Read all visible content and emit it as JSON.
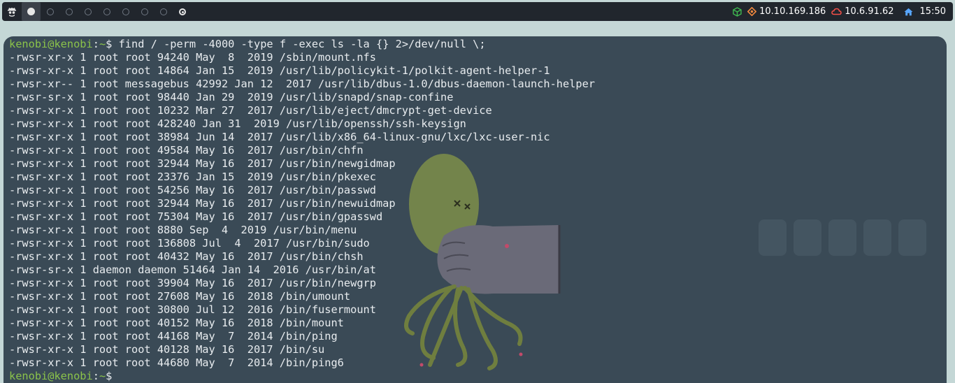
{
  "topbar": {
    "workspaces": [
      {
        "id": 1,
        "state": "active"
      },
      {
        "id": 2,
        "state": "empty"
      },
      {
        "id": 3,
        "state": "empty"
      },
      {
        "id": 4,
        "state": "empty"
      },
      {
        "id": 5,
        "state": "empty"
      },
      {
        "id": 6,
        "state": "empty"
      },
      {
        "id": 7,
        "state": "empty"
      },
      {
        "id": 8,
        "state": "empty"
      },
      {
        "id": 9,
        "state": "target"
      }
    ],
    "status": {
      "target_ip": "10.10.169.186",
      "vpn_ip": "10.6.91.62",
      "time": "15:50"
    },
    "colors": {
      "bar": "#21262d",
      "green": "#3fb950",
      "orange": "#f0883e",
      "red": "#f85149",
      "blue": "#58a6ff"
    }
  },
  "terminal": {
    "prompt": {
      "user_host": "kenobi@kenobi",
      "sep": ":",
      "path": "~",
      "symbol": "$"
    },
    "command": " find / -perm -4000 -type f -exec ls -la {} 2>/dev/null \\;",
    "output": [
      "-rwsr-xr-x 1 root root 94240 May  8  2019 /sbin/mount.nfs",
      "-rwsr-xr-x 1 root root 14864 Jan 15  2019 /usr/lib/policykit-1/polkit-agent-helper-1",
      "-rwsr-xr-- 1 root messagebus 42992 Jan 12  2017 /usr/lib/dbus-1.0/dbus-daemon-launch-helper",
      "-rwsr-sr-x 1 root root 98440 Jan 29  2019 /usr/lib/snapd/snap-confine",
      "-rwsr-xr-x 1 root root 10232 Mar 27  2017 /usr/lib/eject/dmcrypt-get-device",
      "-rwsr-xr-x 1 root root 428240 Jan 31  2019 /usr/lib/openssh/ssh-keysign",
      "-rwsr-xr-x 1 root root 38984 Jun 14  2017 /usr/lib/x86_64-linux-gnu/lxc/lxc-user-nic",
      "-rwsr-xr-x 1 root root 49584 May 16  2017 /usr/bin/chfn",
      "-rwsr-xr-x 1 root root 32944 May 16  2017 /usr/bin/newgidmap",
      "-rwsr-xr-x 1 root root 23376 Jan 15  2019 /usr/bin/pkexec",
      "-rwsr-xr-x 1 root root 54256 May 16  2017 /usr/bin/passwd",
      "-rwsr-xr-x 1 root root 32944 May 16  2017 /usr/bin/newuidmap",
      "-rwsr-xr-x 1 root root 75304 May 16  2017 /usr/bin/gpasswd",
      "-rwsr-xr-x 1 root root 8880 Sep  4  2019 /usr/bin/menu",
      "-rwsr-xr-x 1 root root 136808 Jul  4  2017 /usr/bin/sudo",
      "-rwsr-xr-x 1 root root 40432 May 16  2017 /usr/bin/chsh",
      "-rwsr-sr-x 1 daemon daemon 51464 Jan 14  2016 /usr/bin/at",
      "-rwsr-xr-x 1 root root 39904 May 16  2017 /usr/bin/newgrp",
      "-rwsr-xr-x 1 root root 27608 May 16  2018 /bin/umount",
      "-rwsr-xr-x 1 root root 30800 Jul 12  2016 /bin/fusermount",
      "-rwsr-xr-x 1 root root 40152 May 16  2018 /bin/mount",
      "-rwsr-xr-x 1 root root 44168 May  7  2014 /bin/ping",
      "-rwsr-xr-x 1 root root 40128 May 16  2017 /bin/su",
      "-rwsr-xr-x 1 root root 44680 May  7  2014 /bin/ping6"
    ]
  }
}
